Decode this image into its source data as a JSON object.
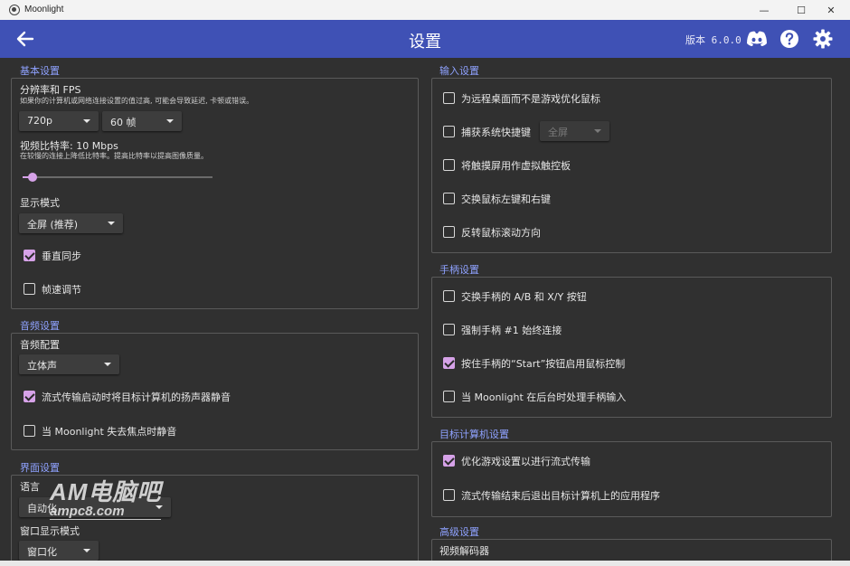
{
  "window": {
    "title": "Moonlight",
    "min": "—",
    "max": "☐",
    "close": "✕"
  },
  "appbar": {
    "title": "设置",
    "version": "版本 6.0.0",
    "back_icon": "back-arrow-icon",
    "discord_icon": "discord-icon",
    "help_icon": "help-icon",
    "settings_icon": "gear-icon",
    "color": "#3f51b5"
  },
  "basic": {
    "title": "基本设置",
    "resolution_label": "分辨率和 FPS",
    "resolution_hint": "如果你的计算机或网络连接设置的值过高, 可能会导致延迟, 卡顿或错误。",
    "resolution_value": "720p",
    "fps_value": "60 帧",
    "bitrate_label": "视频比特率: 10 Mbps",
    "bitrate_hint": "在较慢的连接上降低比特率。提高比特率以提高图像质量。",
    "bitrate_fraction": 0.05,
    "display_mode_label": "显示模式",
    "display_mode_value": "全屏 (推荐)",
    "vsync_label": "垂直同步",
    "vsync_checked": true,
    "frame_pacing_label": "帧速调节",
    "frame_pacing_checked": false
  },
  "audio": {
    "title": "音频设置",
    "config_label": "音频配置",
    "config_value": "立体声",
    "mute_host_label": "流式传输启动时将目标计算机的扬声器静音",
    "mute_host_checked": true,
    "mute_unfocused_label": "当 Moonlight 失去焦点时静音",
    "mute_unfocused_checked": false
  },
  "ui": {
    "title": "界面设置",
    "language_label": "语言",
    "language_value": "自动化",
    "window_mode_label": "窗口显示模式",
    "window_mode_value": "窗口化"
  },
  "input": {
    "title": "输入设置",
    "opt_mouse_label": "为远程桌面而不是游戏优化鼠标",
    "opt_mouse_checked": false,
    "capture_keys_label": "捕获系统快捷键",
    "capture_keys_checked": false,
    "capture_keys_value": "全屏",
    "touchscreen_label": "将触摸屏用作虚拟触控板",
    "touchscreen_checked": false,
    "swap_mouse_label": "交换鼠标左键和右键",
    "swap_mouse_checked": false,
    "reverse_scroll_label": "反转鼠标滚动方向",
    "reverse_scroll_checked": false
  },
  "gamepad": {
    "title": "手柄设置",
    "swap_ab_label": "交换手柄的 A/B 和 X/Y 按钮",
    "swap_ab_checked": false,
    "force_gamepad_label": "强制手柄 #1 始终连接",
    "force_gamepad_checked": false,
    "start_mouse_label": "按住手柄的“Start”按钮启用鼠标控制",
    "start_mouse_checked": true,
    "background_input_label": "当 Moonlight 在后台时处理手柄输入",
    "background_input_checked": false
  },
  "host": {
    "title": "目标计算机设置",
    "optimize_label": "优化游戏设置以进行流式传输",
    "optimize_checked": true,
    "quit_app_label": "流式传输结束后退出目标计算机上的应用程序",
    "quit_app_checked": false
  },
  "advanced": {
    "title": "高级设置",
    "decoder_label": "视频解码器"
  },
  "watermark": {
    "line1": "AM电脑吧",
    "line2": "ampc8.com"
  },
  "colors": {
    "accent": "#d6a2e8",
    "group_title": "#8fa2ff",
    "background": "#303030"
  }
}
